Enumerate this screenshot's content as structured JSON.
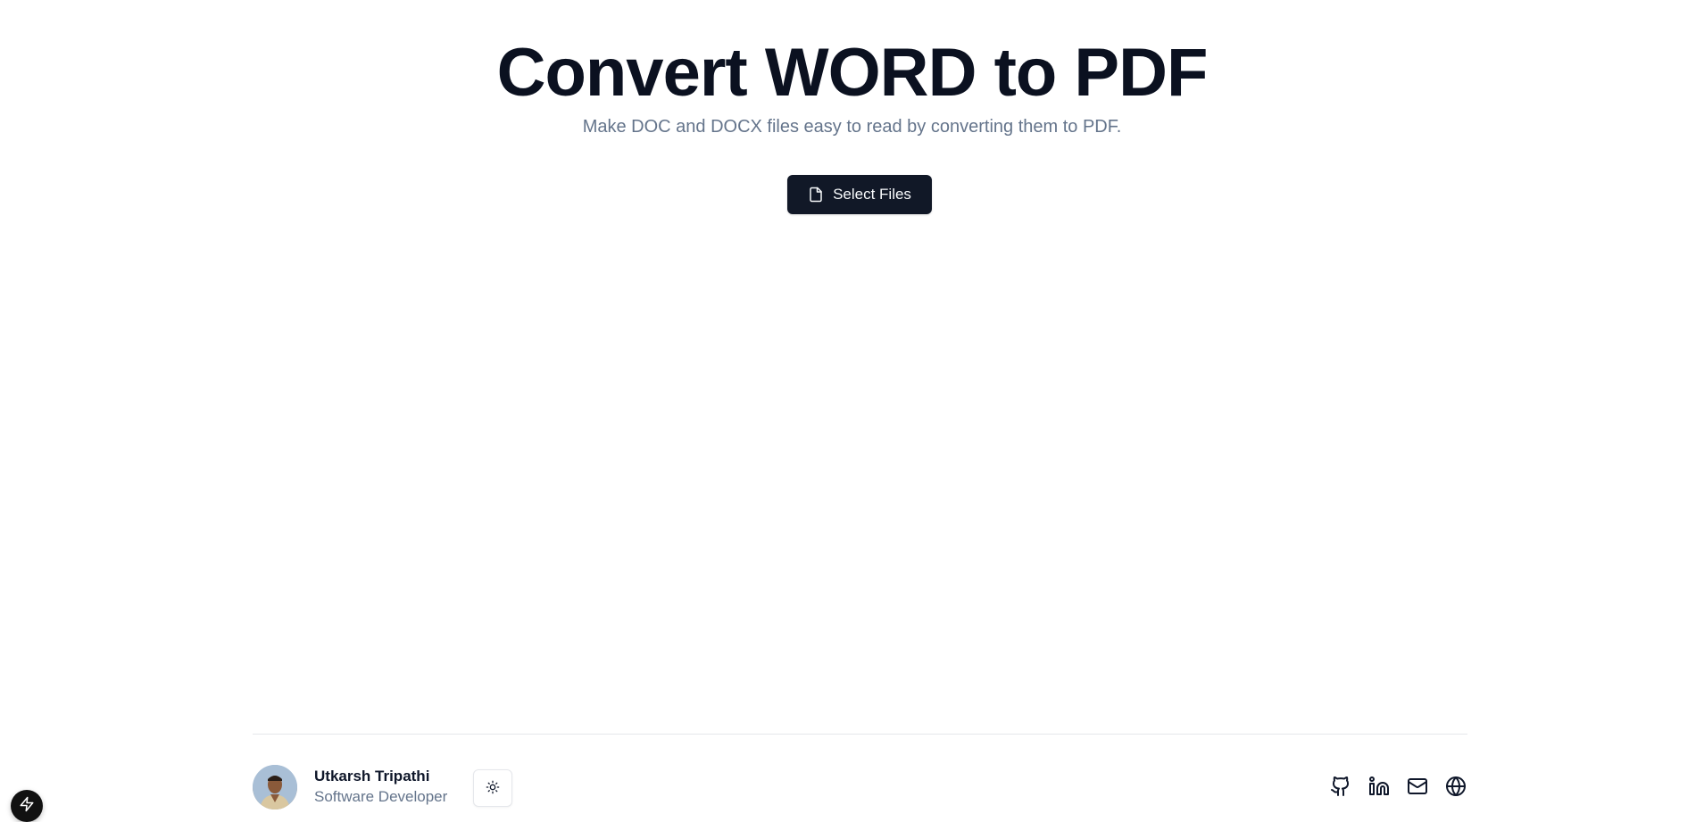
{
  "hero": {
    "title": "Convert WORD to PDF",
    "subtitle": "Make DOC and DOCX files easy to read by converting them to PDF."
  },
  "upload": {
    "select_label": "Select Files",
    "icon": "file-icon"
  },
  "footer": {
    "author_name": "Utkarsh Tripathi",
    "author_role": "Software Developer",
    "theme_toggle_icon": "sun-icon",
    "socials": [
      {
        "name": "github",
        "icon": "github-icon"
      },
      {
        "name": "linkedin",
        "icon": "linkedin-icon"
      },
      {
        "name": "email",
        "icon": "mail-icon"
      },
      {
        "name": "website",
        "icon": "globe-icon"
      }
    ]
  },
  "dev_badge": {
    "icon": "lightning-icon"
  },
  "colors": {
    "primary_button": "#111827",
    "title": "#0b1120",
    "muted_text": "#64748b",
    "border": "#e5e7eb"
  }
}
